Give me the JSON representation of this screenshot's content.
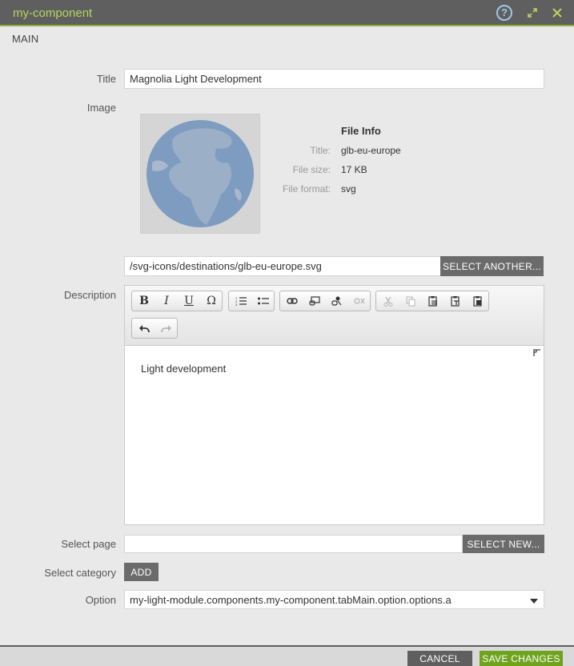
{
  "dialog": {
    "title": "my-component",
    "help_icon": "help-icon",
    "expand_icon": "expand-icon",
    "close_icon": "close-icon",
    "accent": "#8db53e",
    "title_color": "#b6d65e"
  },
  "tab": {
    "label": "MAIN"
  },
  "fields": {
    "title": {
      "label": "Title",
      "value": "Magnolia Light Development"
    },
    "image": {
      "label": "Image",
      "file_info_heading": "File Info",
      "info": [
        {
          "label": "Title:",
          "value": "glb-eu-europe"
        },
        {
          "label": "File size:",
          "value": "17 KB"
        },
        {
          "label": "File format:",
          "value": "svg"
        }
      ],
      "path": "/svg-icons/destinations/glb-eu-europe.svg",
      "select_button": "SELECT ANOTHER..."
    },
    "description": {
      "label": "Description",
      "content": "Light development",
      "toolbar": {
        "format": [
          "bold-icon",
          "italic-icon",
          "underline-icon",
          "omega-icon"
        ],
        "lists": [
          "ordered-list-icon",
          "unordered-list-icon"
        ],
        "links": [
          "link-icon",
          "internal-link-icon",
          "asset-link-icon",
          "unlink-icon"
        ],
        "clipboard": [
          "cut-icon",
          "copy-icon",
          "paste-icon",
          "paste-text-icon",
          "paste-word-icon"
        ],
        "history": [
          "undo-icon",
          "redo-icon"
        ]
      }
    },
    "select_page": {
      "label": "Select page",
      "value": "",
      "button": "SELECT NEW..."
    },
    "select_category": {
      "label": "Select category",
      "button": "ADD"
    },
    "option": {
      "label": "Option",
      "value": "my-light-module.components.my-component.tabMain.option.options.a"
    }
  },
  "footer": {
    "cancel": "CANCEL",
    "save": "SAVE CHANGES"
  }
}
